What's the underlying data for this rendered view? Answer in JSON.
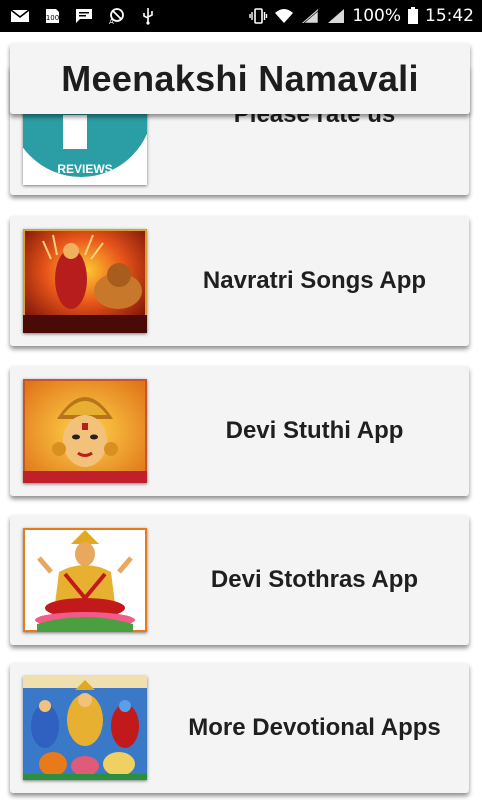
{
  "status_bar": {
    "battery_percent": "100%",
    "time": "15:42",
    "icons": [
      "mail-icon",
      "storage-icon",
      "message-icon",
      "phone-missed-icon",
      "usb-icon",
      "vibrate-icon",
      "wifi-icon",
      "signal-icon",
      "signal-icon-2",
      "battery-icon"
    ]
  },
  "app": {
    "title": "Meenakshi Namavali"
  },
  "cards": [
    {
      "label": "Please rate us",
      "thumb": "reviews-icon-thumbnail",
      "thumb_text": "REVIEWS"
    },
    {
      "label": "Navratri Songs App",
      "thumb": "durga-lion-thumbnail"
    },
    {
      "label": "Devi Stuthi App",
      "thumb": "devi-face-thumbnail"
    },
    {
      "label": "Devi Stothras App",
      "thumb": "seated-devi-thumbnail"
    },
    {
      "label": "More Devotional Apps",
      "thumb": "deities-collage-thumbnail"
    }
  ],
  "colors": {
    "status_bar": "#000000",
    "card_background": "#f4f4f4",
    "reviews_teal": "#2a9ea4",
    "text": "#1f1f1f"
  }
}
